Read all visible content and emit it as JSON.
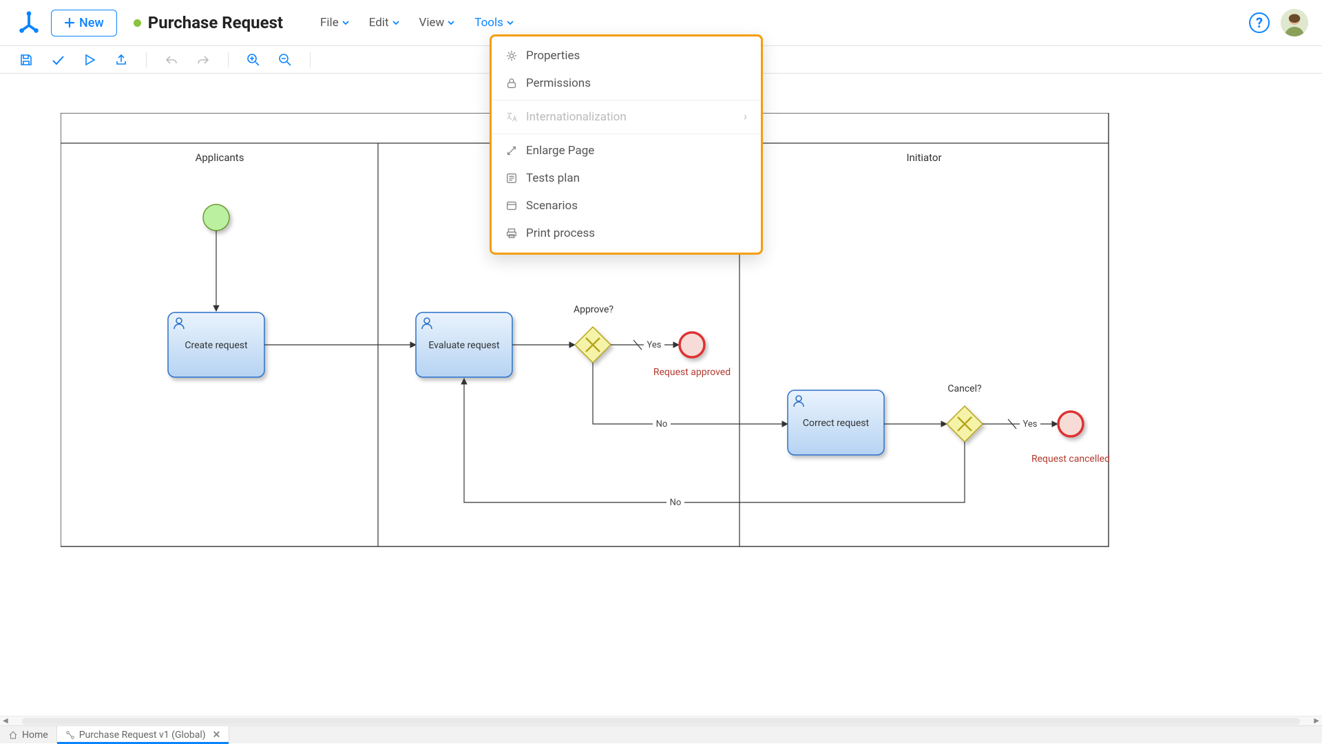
{
  "header": {
    "new_button": "New",
    "title": "Purchase Request",
    "menus": {
      "file": "File",
      "edit": "Edit",
      "view": "View",
      "tools": "Tools"
    }
  },
  "tools_menu": {
    "properties": "Properties",
    "permissions": "Permissions",
    "internationalization": "Internationalization",
    "enlarge_page": "Enlarge Page",
    "tests_plan": "Tests plan",
    "scenarios": "Scenarios",
    "print_process": "Print process"
  },
  "pool": {
    "lanes": {
      "applicants": "Applicants",
      "evaluator": "",
      "initiator": "Initiator"
    }
  },
  "nodes": {
    "create_request": "Create request",
    "evaluate_request": "Evaluate request",
    "correct_request": "Correct request",
    "approve_gateway": "Approve?",
    "cancel_gateway": "Cancel?",
    "end_approved": "Request approved",
    "end_cancelled": "Request cancelled"
  },
  "edges": {
    "yes": "Yes",
    "no": "No"
  },
  "tabs": {
    "home": "Home",
    "process": "Purchase Request v1 (Global)"
  }
}
